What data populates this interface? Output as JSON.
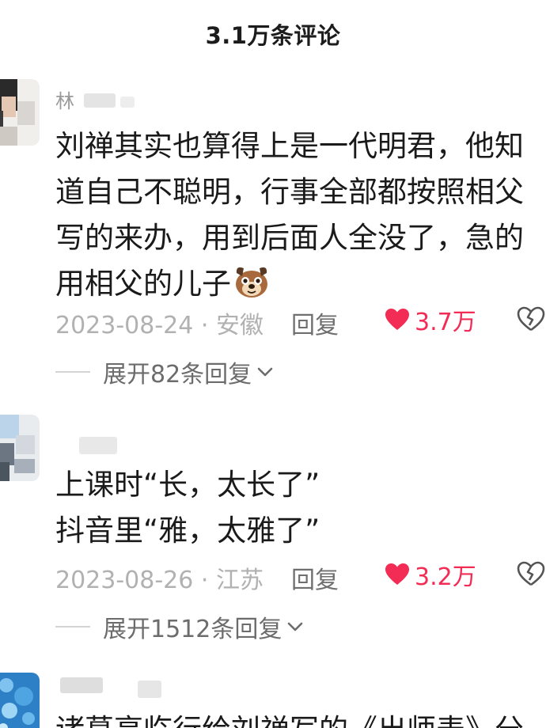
{
  "header": {
    "title": "3.1万条评论"
  },
  "comments": [
    {
      "username": "林",
      "lines": [
        "刘禅其实也算得上是一代明君，他知",
        "道自己不聪明，行事全部都按照相父",
        "写的来办，用到后面人全没了，急的",
        "用相父的儿子"
      ],
      "date_location": "2023-08-24 · 安徽",
      "reply_label": "回复",
      "likes": "3.7万",
      "expand_label": "展开82条回复"
    },
    {
      "username": "",
      "lines": [
        "上课时“长，太长了”",
        "抖音里“雅，太雅了”"
      ],
      "date_location": "2023-08-26 · 江苏",
      "reply_label": "回复",
      "likes": "3.2万",
      "expand_label": "展开1512条回复"
    },
    {
      "username": "",
      "lines": [
        "诸葛亮临行给刘禅写的《出师表》分"
      ]
    }
  ],
  "colors": {
    "like": "#f22c54",
    "muted": "#b1b1b1",
    "text": "#1a1a1a"
  },
  "icons": {
    "like": "heart-icon",
    "dislike": "broken-heart-icon",
    "expand": "chevron-down-icon"
  }
}
